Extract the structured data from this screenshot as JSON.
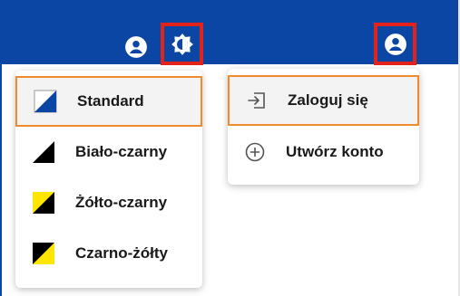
{
  "contrast_menu": {
    "items": [
      {
        "label": "Standard",
        "selected": true,
        "colors": {
          "top": "#ffffff",
          "bottom": "#0b46a5"
        },
        "icon": "contrast-standard-icon"
      },
      {
        "label": "Biało-czarny",
        "selected": false,
        "colors": {
          "top": "#ffffff",
          "bottom": "#000000"
        },
        "icon": "contrast-white-black-icon"
      },
      {
        "label": "Żółto-czarny",
        "selected": false,
        "colors": {
          "top": "#ffe600",
          "bottom": "#000000"
        },
        "icon": "contrast-yellow-black-icon"
      },
      {
        "label": "Czarno-żółty",
        "selected": false,
        "colors": {
          "top": "#000000",
          "bottom": "#ffe600"
        },
        "icon": "contrast-black-yellow-icon"
      }
    ]
  },
  "account_menu": {
    "items": [
      {
        "label": "Zaloguj się",
        "selected": true,
        "icon": "login-icon"
      },
      {
        "label": "Utwórz konto",
        "selected": false,
        "icon": "plus-circle-icon"
      }
    ]
  },
  "colors": {
    "bar": "#0b46a5",
    "highlight": "#e2231a",
    "selected_border": "#f08b2b"
  }
}
